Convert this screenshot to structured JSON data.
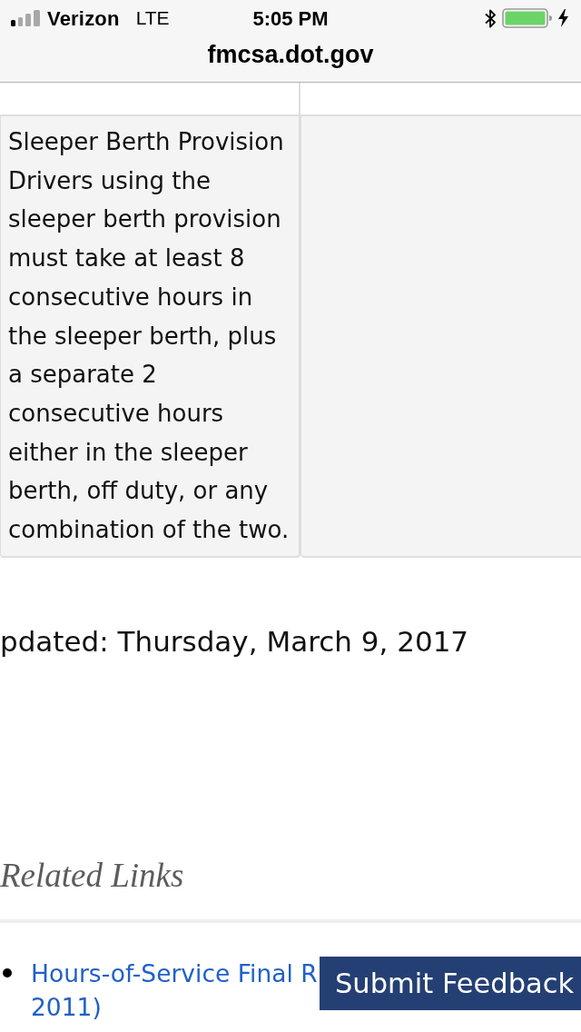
{
  "status_bar": {
    "carrier": "Verizon",
    "network": "LTE",
    "time": "5:05 PM"
  },
  "address_bar": {
    "url": "fmcsa.dot.gov"
  },
  "table": {
    "rows": [
      {
        "kind": "blank"
      },
      {
        "kind": "text",
        "heading": "Sleeper Berth Provision",
        "text": "Drivers using the sleeper berth provision must take at least 8 consecutive hours in the sleeper berth, plus a separate 2 consecutive hours either in the sleeper berth, off duty, or any combination of the two."
      }
    ]
  },
  "last_updated": "pdated: Thursday, March 9, 2017",
  "related_links": {
    "heading": "Related Links",
    "items": [
      {
        "lines": [
          "Hours-of-Service Final R",
          "2011)"
        ]
      }
    ]
  },
  "feedback_button": {
    "label": "Submit Feedback"
  }
}
